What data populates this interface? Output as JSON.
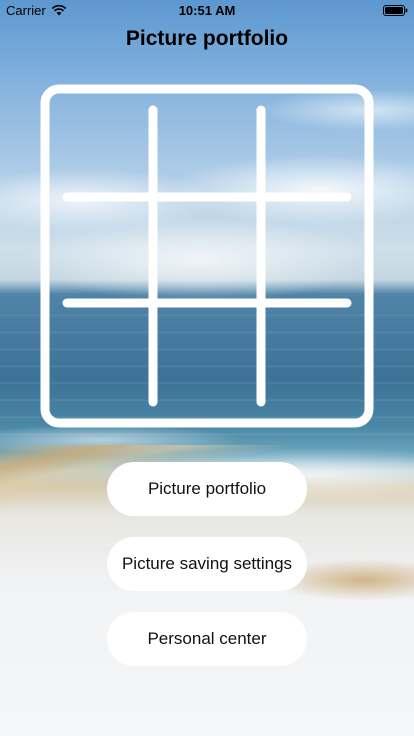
{
  "status_bar": {
    "carrier": "Carrier",
    "time": "10:51 AM",
    "wifi_icon": "wifi-icon",
    "battery_icon": "battery-icon"
  },
  "header": {
    "title": "Picture portfolio"
  },
  "main": {
    "grid_icon": "grid-3x3-icon",
    "buttons": [
      {
        "label": "Picture portfolio"
      },
      {
        "label": "Picture saving settings"
      },
      {
        "label": "Personal center"
      }
    ]
  },
  "colors": {
    "button_bg": "#ffffff",
    "text": "#000000",
    "grid_stroke": "#ffffff"
  }
}
